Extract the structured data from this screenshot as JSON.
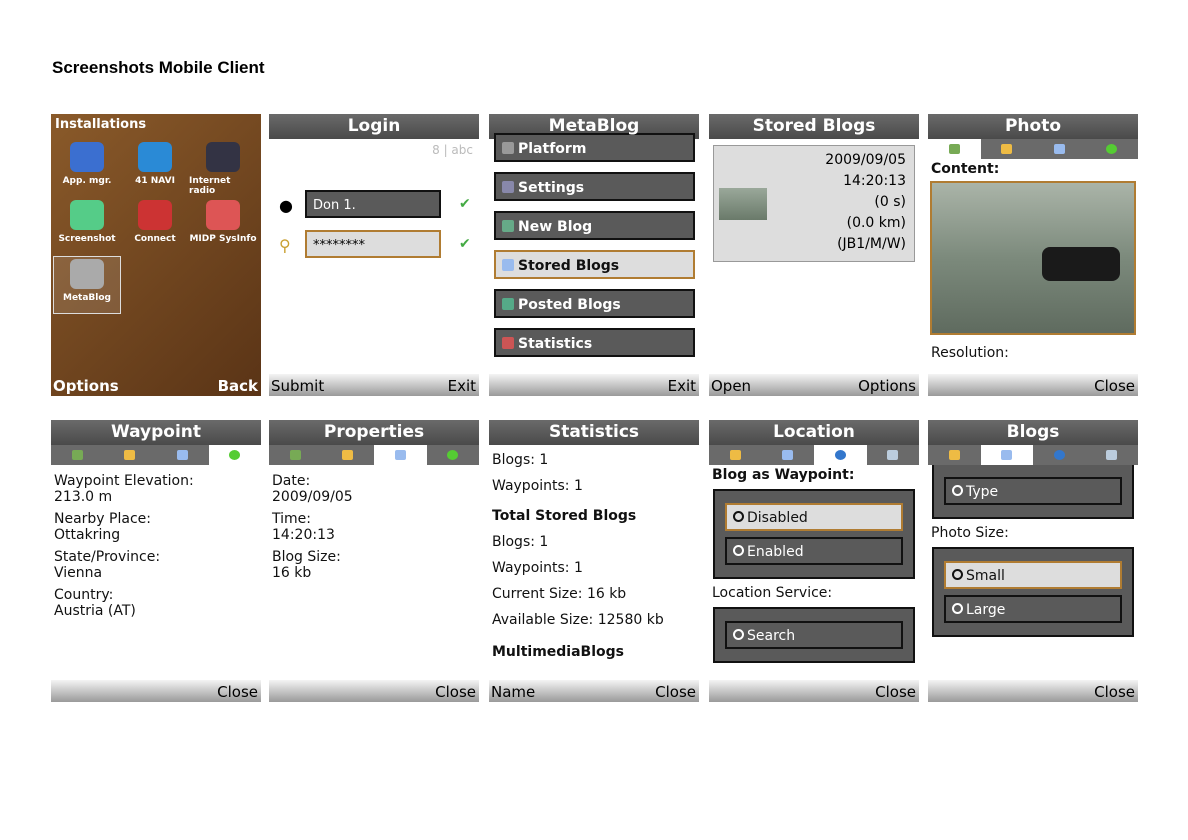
{
  "page": {
    "title": "Screenshots Mobile Client"
  },
  "installations": {
    "title": "Installations",
    "apps": [
      {
        "label": "App. mgr.",
        "color": "#3b6fd0"
      },
      {
        "label": "41 NAVI",
        "color": "#2a8ad6"
      },
      {
        "label": "Internet radio",
        "color": "#334"
      },
      {
        "label": "Screenshot",
        "color": "#5c8"
      },
      {
        "label": "Connect",
        "color": "#c33"
      },
      {
        "label": "MIDP SysInfo",
        "color": "#d55"
      },
      {
        "label": "MetaBlog",
        "color": "#aaa"
      }
    ],
    "softkeys": {
      "left": "Options",
      "right": "Back"
    }
  },
  "login": {
    "title": "Login",
    "mode": "8 | abc",
    "username": "Don 1.",
    "password": "********",
    "softkeys": {
      "left": "Submit",
      "right": "Exit"
    }
  },
  "metablog": {
    "title": "MetaBlog",
    "items": [
      "Platform",
      "Settings",
      "New Blog",
      "Stored Blogs",
      "Posted Blogs",
      "Statistics"
    ],
    "softkeys": {
      "right": "Exit"
    }
  },
  "stored": {
    "title": "Stored Blogs",
    "lines": [
      "2009/09/05",
      "14:20:13",
      "(0 s)",
      "(0.0 km)",
      "(JB1/M/W)"
    ],
    "softkeys": {
      "left": "Open",
      "right": "Options"
    }
  },
  "photo": {
    "title": "Photo",
    "content_label": "Content:",
    "resolution_label": "Resolution:",
    "softkeys": {
      "right": "Close"
    }
  },
  "waypoint": {
    "title": "Waypoint",
    "fields": [
      {
        "label": "Waypoint Elevation:",
        "value": "213.0 m"
      },
      {
        "label": "Nearby Place:",
        "value": "Ottakring"
      },
      {
        "label": "State/Province:",
        "value": "Vienna"
      },
      {
        "label": "Country:",
        "value": "Austria (AT)"
      }
    ],
    "softkeys": {
      "right": "Close"
    }
  },
  "properties": {
    "title": "Properties",
    "fields": [
      {
        "label": "Date:",
        "value": "2009/09/05"
      },
      {
        "label": "Time:",
        "value": "14:20:13"
      },
      {
        "label": "Blog Size:",
        "value": "16 kb"
      }
    ],
    "softkeys": {
      "right": "Close"
    }
  },
  "statistics": {
    "title": "Statistics",
    "lines": [
      "Blogs: 1",
      "Waypoints: 1"
    ],
    "heading": "Total Stored Blogs",
    "lines2": [
      "Blogs: 1",
      "Waypoints: 1",
      "Current Size: 16 kb",
      "Available Size: 12580 kb"
    ],
    "heading2": "MultimediaBlogs",
    "softkeys": {
      "left": "Name",
      "right": "Close"
    }
  },
  "location": {
    "title": "Location",
    "blog_as_waypoint": "Blog as Waypoint:",
    "options": [
      "Disabled",
      "Enabled"
    ],
    "service_label": "Location Service:",
    "service_option": "Search",
    "softkeys": {
      "right": "Close"
    }
  },
  "blogs": {
    "title": "Blogs",
    "type_option": "Type",
    "photo_size_label": "Photo Size:",
    "sizes": [
      "Small",
      "Large"
    ],
    "softkeys": {
      "right": "Close"
    }
  }
}
